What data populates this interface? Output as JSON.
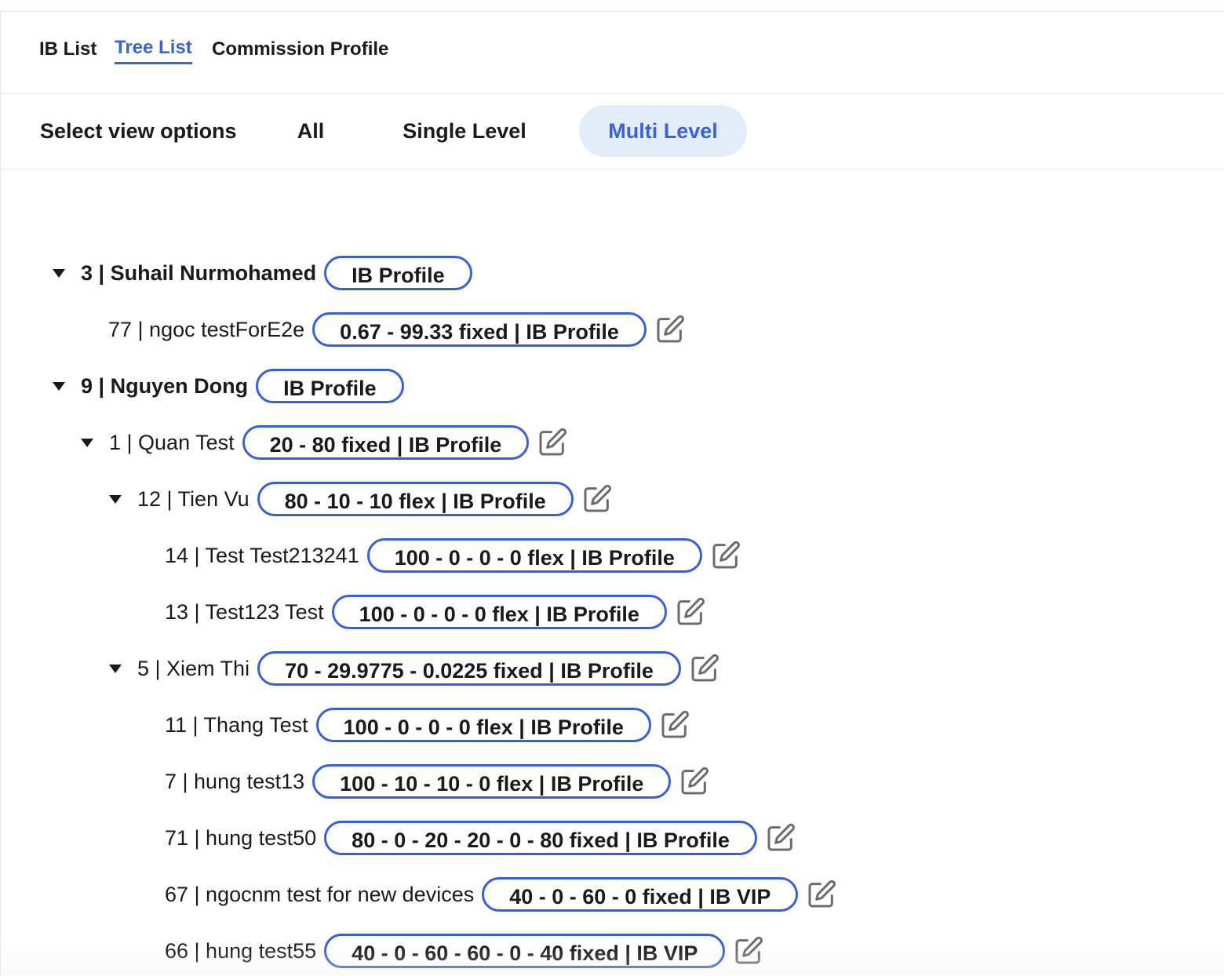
{
  "tabs": [
    {
      "label": "IB List",
      "active": false
    },
    {
      "label": "Tree List",
      "active": true
    },
    {
      "label": "Commission Profile",
      "active": false
    }
  ],
  "view_options": {
    "label": "Select view options",
    "options": [
      {
        "label": "All",
        "active": false
      },
      {
        "label": "Single Level",
        "active": false
      },
      {
        "label": "Multi Level",
        "active": true
      }
    ]
  },
  "tree": [
    {
      "label": "3 | Suhail Nurmohamed",
      "profile": "IB Profile",
      "expandable": true,
      "editable": false
    },
    {
      "label": "77 | ngoc testForE2e",
      "profile": "0.67 - 99.33 fixed | IB Profile",
      "expandable": false,
      "editable": true
    },
    {
      "label": "9 | Nguyen Dong",
      "profile": "IB Profile",
      "expandable": true,
      "editable": false
    },
    {
      "label": "1 | Quan Test",
      "profile": "20 - 80 fixed | IB Profile",
      "expandable": true,
      "editable": true
    },
    {
      "label": "12 | Tien Vu",
      "profile": "80 - 10 - 10 flex | IB Profile",
      "expandable": true,
      "editable": true
    },
    {
      "label": "14 | Test Test213241",
      "profile": "100 - 0 - 0 - 0 flex | IB Profile",
      "expandable": false,
      "editable": true
    },
    {
      "label": "13 | Test123 Test",
      "profile": "100 - 0 - 0 - 0 flex | IB Profile",
      "expandable": false,
      "editable": true
    },
    {
      "label": "5 | Xiem Thi",
      "profile": "70 - 29.9775 - 0.0225 fixed | IB Profile",
      "expandable": true,
      "editable": true
    },
    {
      "label": "11 | Thang Test",
      "profile": "100 - 0 - 0 - 0 flex | IB Profile",
      "expandable": false,
      "editable": true
    },
    {
      "label": "7 | hung test13",
      "profile": "100 - 10 - 10 - 0 flex | IB Profile",
      "expandable": false,
      "editable": true
    },
    {
      "label": "71 | hung test50",
      "profile": "80 - 0 - 20 - 20 - 0 - 80 fixed | IB Profile",
      "expandable": false,
      "editable": true
    },
    {
      "label": "67 | ngocnm test for new devices",
      "profile": "40 - 0 - 60 - 0 fixed | IB VIP",
      "expandable": false,
      "editable": true
    },
    {
      "label": "66 | hung test55",
      "profile": "40 - 0 - 60 - 60 - 0 - 40 fixed | IB VIP",
      "expandable": false,
      "editable": true
    }
  ],
  "colors": {
    "accent": "#3a63d6",
    "pill_border": "#3a5fd0",
    "active_bg": "#e2edf8",
    "icon": "#6b6b6b"
  },
  "icons": {
    "caret": "caret-down-icon",
    "edit": "edit-icon"
  }
}
